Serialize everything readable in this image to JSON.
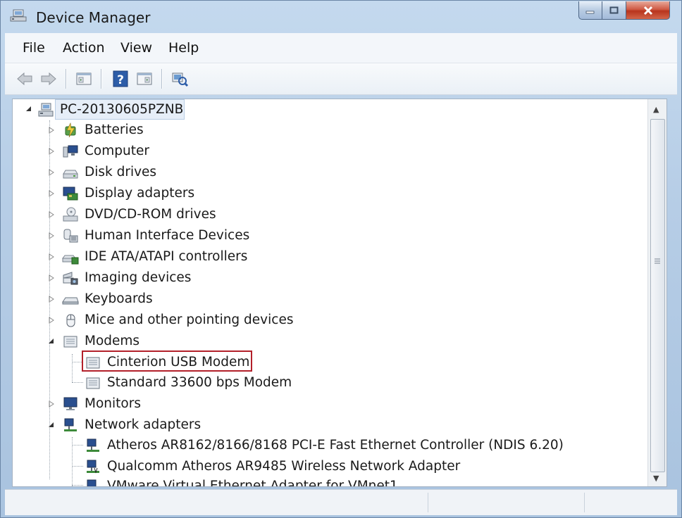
{
  "window": {
    "title": "Device Manager",
    "icon": "device-manager-icon",
    "accent_color": "#b3202a"
  },
  "menu": {
    "file": "File",
    "action": "Action",
    "view": "View",
    "help": "Help"
  },
  "toolbar": {
    "buttons": [
      "back-arrow-icon",
      "forward-arrow-icon",
      "properties-icon",
      "help-icon",
      "show-hide-console-icon",
      "scan-hardware-icon"
    ]
  },
  "tree": {
    "root": "PC-20130605PZNB",
    "categories": [
      {
        "label": "Batteries",
        "icon": "battery-icon",
        "expanded": false
      },
      {
        "label": "Computer",
        "icon": "computer-icon",
        "expanded": false
      },
      {
        "label": "Disk drives",
        "icon": "disk-drive-icon",
        "expanded": false
      },
      {
        "label": "Display adapters",
        "icon": "display-adapter-icon",
        "expanded": false
      },
      {
        "label": "DVD/CD-ROM drives",
        "icon": "dvd-drive-icon",
        "expanded": false
      },
      {
        "label": "Human Interface Devices",
        "icon": "hid-icon",
        "expanded": false
      },
      {
        "label": "IDE ATA/ATAPI controllers",
        "icon": "ide-controller-icon",
        "expanded": false
      },
      {
        "label": "Imaging devices",
        "icon": "imaging-device-icon",
        "expanded": false
      },
      {
        "label": "Keyboards",
        "icon": "keyboard-icon",
        "expanded": false
      },
      {
        "label": "Mice and other pointing devices",
        "icon": "mouse-icon",
        "expanded": false
      },
      {
        "label": "Modems",
        "icon": "modem-icon",
        "expanded": true,
        "children": [
          "Cinterion USB Modem",
          "Standard 33600 bps Modem"
        ]
      },
      {
        "label": "Monitors",
        "icon": "monitor-icon",
        "expanded": false
      },
      {
        "label": "Network adapters",
        "icon": "network-adapter-icon",
        "expanded": true,
        "children": [
          "Atheros AR8162/8166/8168 PCI-E Fast Ethernet Controller (NDIS 6.20)",
          "Qualcomm Atheros AR9485 Wireless Network Adapter",
          "VMware Virtual Ethernet Adapter for VMnet1"
        ]
      }
    ],
    "highlighted": "Cinterion USB Modem"
  }
}
